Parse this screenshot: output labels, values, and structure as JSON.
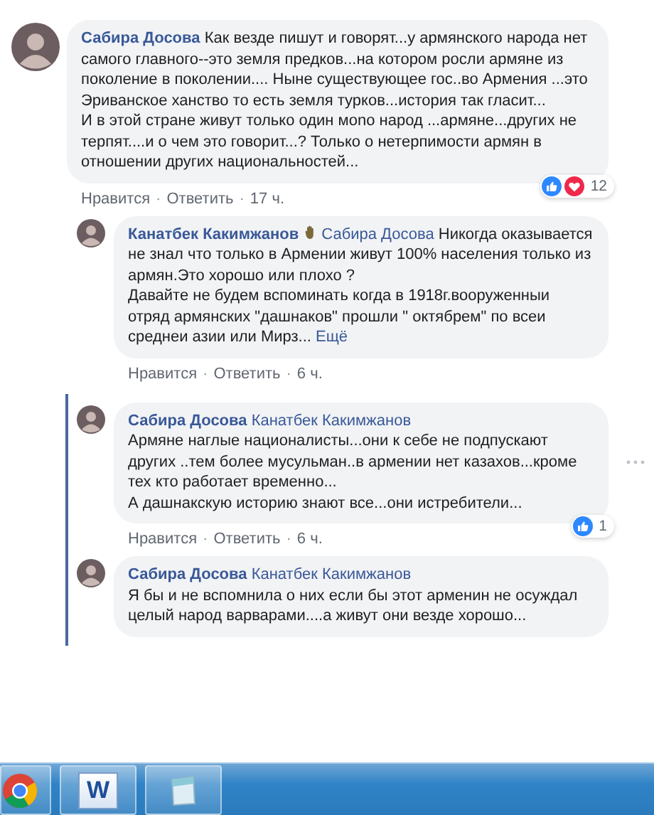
{
  "comments": [
    {
      "author": "Сабира Досова",
      "text": "Как везде пишут и говорят...у армянского народа нет самого главного--это земля предков...на котором росли армяне из поколение в поколении.... Ныне существующее гос..во Армения ...это Эриванское ханство то есть земля турков...история так гласит...\nИ в этой стране живут только один мono народ ...армяне...других не терпят....и о чем это говорит...? Только о нетерпимости армян в отношении других национальностей...",
      "actions": [
        {
          "kind": "like",
          "text": "Нравится"
        },
        {
          "kind": "sep",
          "text": "·"
        },
        {
          "kind": "reply",
          "text": "Ответить"
        },
        {
          "kind": "sep",
          "text": "·"
        },
        {
          "kind": "time",
          "text": "17 ч."
        }
      ],
      "reactions": [
        {
          "kind": "like"
        },
        {
          "kind": "love"
        }
      ],
      "reaction_count": "12",
      "children": [
        {
          "author": "Канатбек Какимжанов",
          "badge": true,
          "mention": "Сабира Досова",
          "text": "Никогда оказывается не знал что только в Армении живут 100% населения только из армян.Это хорошо или плохо ?\nДавайте не будем вспоминать когда в 1918г.вооруженныи отряд армянских \"дашнаков\" прошли \" октябрем\" по всеи среднеи азии или Мирз...",
          "more": "Ещё",
          "actions": [
            {
              "kind": "like",
              "text": "Нравится"
            },
            {
              "kind": "sep",
              "text": "·"
            },
            {
              "kind": "reply",
              "text": "Ответить"
            },
            {
              "kind": "sep",
              "text": "·"
            },
            {
              "kind": "time",
              "text": "6 ч."
            }
          ],
          "children": [
            {
              "author": "Сабира Досова",
              "mention": "Канатбек Какимжанов",
              "text": "\nАрмяне наглые националисты...они к себе не подпускают других ..тем более мусульман..в армении нет казахов...кроме тех кто работает временно...\nА дашнакскую историю знают все...они истребители...",
              "actions": [
                {
                  "kind": "like",
                  "text": "Нравится"
                },
                {
                  "kind": "sep",
                  "text": "·"
                },
                {
                  "kind": "reply",
                  "text": "Ответить"
                },
                {
                  "kind": "sep",
                  "text": "·"
                },
                {
                  "kind": "time",
                  "text": "6 ч."
                }
              ],
              "reactions": [
                {
                  "kind": "like"
                }
              ],
              "reaction_count": "1",
              "menu": true
            },
            {
              "author": "Сабира Досова",
              "mention": "Канатбек Какимжанов",
              "text": "\nЯ бы и не вспомнила о них если бы этот арменин не осуждал целый народ варварами....а живут они везде хорошо..."
            }
          ]
        }
      ]
    }
  ],
  "taskbar": [
    {
      "kind": "chrome"
    },
    {
      "kind": "word",
      "glyph": "W"
    },
    {
      "kind": "notes"
    }
  ]
}
